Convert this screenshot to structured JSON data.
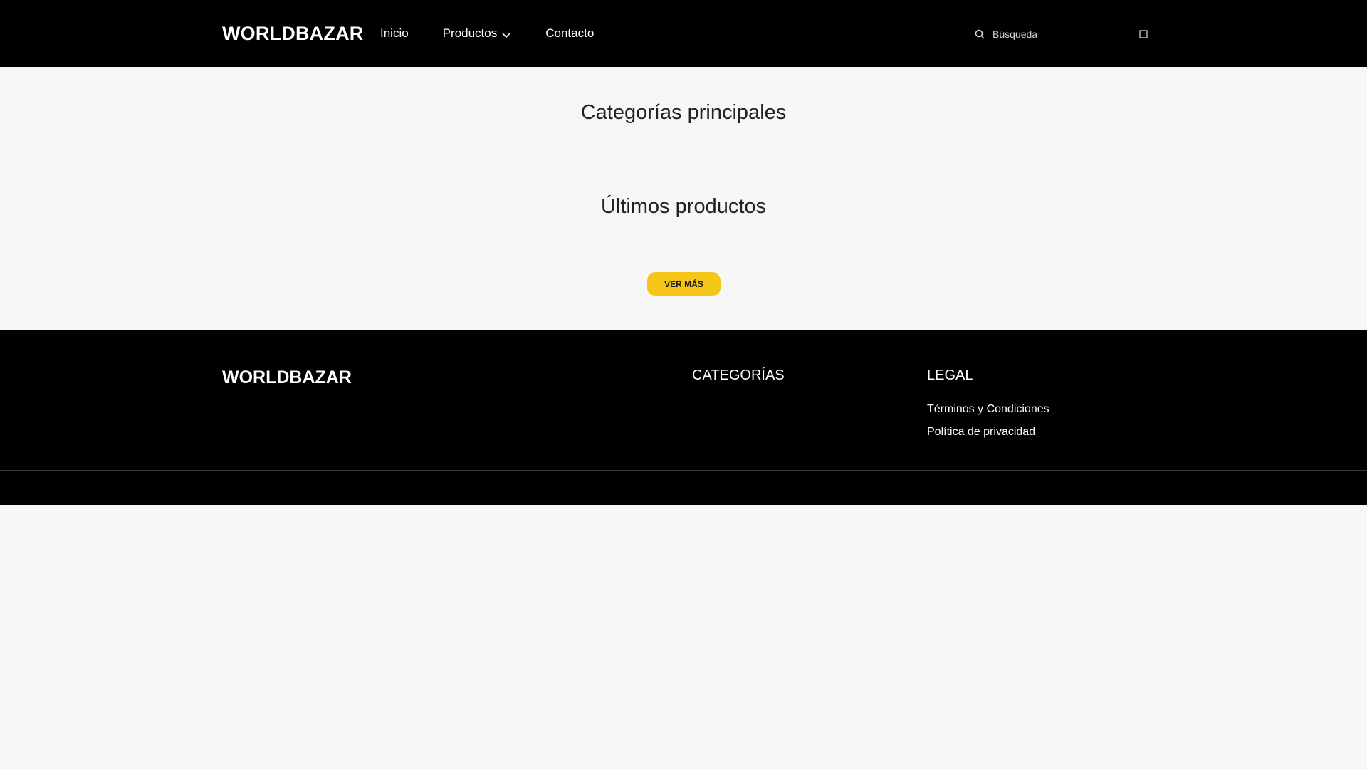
{
  "header": {
    "brand": "WORLDBAZAR",
    "nav": {
      "inicio": "Inicio",
      "productos": "Productos",
      "contacto": "Contacto"
    },
    "search": {
      "placeholder": "Búsqueda",
      "value": ""
    }
  },
  "main": {
    "categorias_title": "Categorías principales",
    "ultimos_title": "Últimos productos",
    "ver_mas_label": "VER MÁS"
  },
  "footer": {
    "brand": "WORLDBAZAR",
    "categorias_heading": "CATEGORÍAS",
    "legal_heading": "LEGAL",
    "legal_links": {
      "terminos": "Términos y Condiciones",
      "privacidad": "Política de privacidad"
    }
  },
  "colors": {
    "header_bg": "#000000",
    "page_bg": "#f7f7f7",
    "accent_button": "#f5c518",
    "footer_bg": "#000000"
  },
  "icons": {
    "search": "search-icon",
    "productos_dropdown": "chevron-down-icon",
    "clear": "close-icon"
  }
}
